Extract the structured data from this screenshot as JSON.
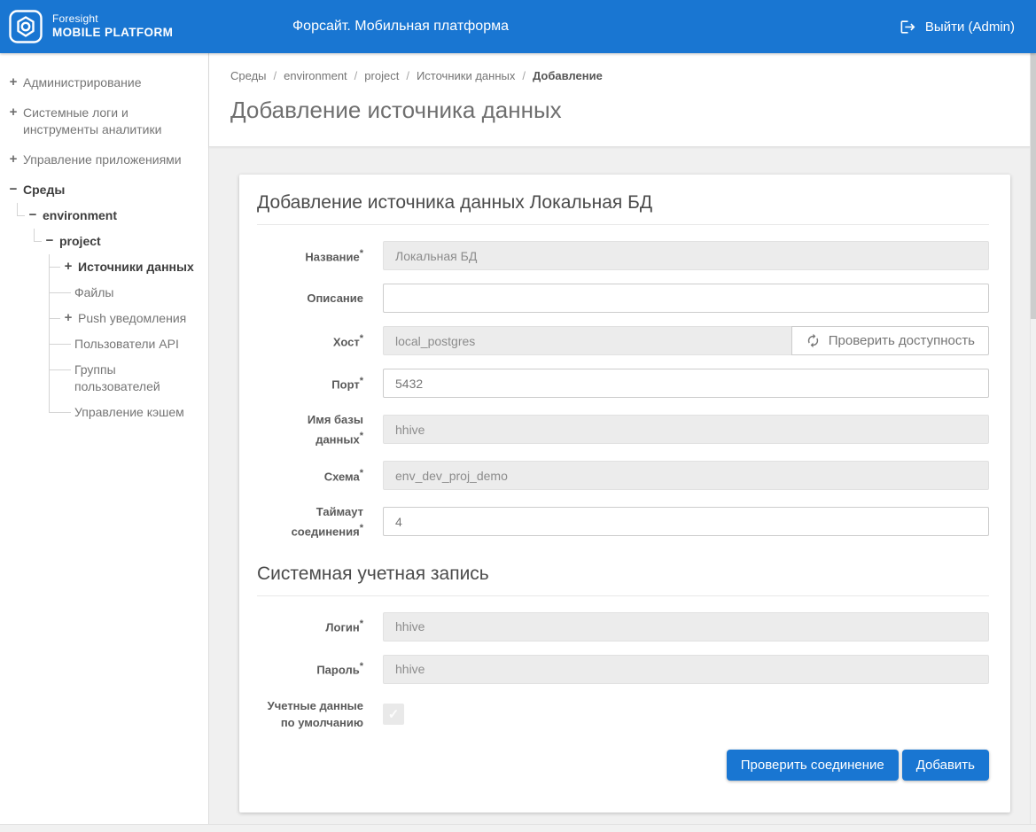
{
  "colors": {
    "header_blue": "#1976d2",
    "button_blue": "#1976d2",
    "page_background": "#f0f0f0",
    "card_background": "#ffffff",
    "disabled_input_background": "#ececec"
  },
  "header": {
    "logo_line1": "Foresight",
    "logo_line2": "MOBILE PLATFORM",
    "title": "Форсайт. Мобильная платформа",
    "logout_label": "Выйти (Admin)"
  },
  "sidebar": {
    "items": [
      {
        "label": "Администрирование",
        "glyph": "+"
      },
      {
        "label": "Системные логи и инструменты аналитики",
        "glyph": "+"
      },
      {
        "label": "Управление приложениями",
        "glyph": "+"
      },
      {
        "label": "Среды",
        "glyph": "−"
      },
      {
        "label": "environment",
        "glyph": "−"
      },
      {
        "label": "project",
        "glyph": "−"
      },
      {
        "label": "Источники данных",
        "glyph": "+"
      },
      {
        "label": "Файлы",
        "glyph": ""
      },
      {
        "label": "Push уведомления",
        "glyph": "+"
      },
      {
        "label": "Пользователи API",
        "glyph": ""
      },
      {
        "label": "Группы пользователей",
        "glyph": ""
      },
      {
        "label": "Управление кэшем",
        "glyph": ""
      }
    ]
  },
  "breadcrumb": {
    "separator": "/",
    "items": [
      "Среды",
      "environment",
      "project",
      "Источники данных",
      "Добавление"
    ]
  },
  "page": {
    "title": "Добавление источника данных"
  },
  "form": {
    "title": "Добавление источника данных Локальная БД",
    "required_mark": "*",
    "fields": [
      {
        "label": "Название",
        "value": "Локальная БД",
        "disabled": true
      },
      {
        "label": "Описание",
        "value": "",
        "disabled": false
      },
      {
        "label": "Хост",
        "value": "local_postgres",
        "disabled": true,
        "append_button_label": "Проверить доступность"
      },
      {
        "label": "Порт",
        "value": "5432",
        "disabled": false
      },
      {
        "label": "Имя базы данных",
        "value": "hhive",
        "disabled": true
      },
      {
        "label": "Схема",
        "value": "env_dev_proj_demo",
        "disabled": true
      },
      {
        "label": "Таймаут соединения",
        "value": "4",
        "disabled": false
      }
    ],
    "section_title": "Системная учетная запись",
    "account_fields": [
      {
        "label": "Логин",
        "value": "hhive",
        "disabled": true
      },
      {
        "label": "Пароль",
        "value": "hhive",
        "disabled": true
      }
    ],
    "checkbox": {
      "label": "Учетные данные по умолчанию",
      "checked": true
    },
    "buttons": {
      "check_connection": "Проверить соединение",
      "add": "Добавить"
    }
  },
  "icons": {
    "check_glyph": "✓"
  }
}
